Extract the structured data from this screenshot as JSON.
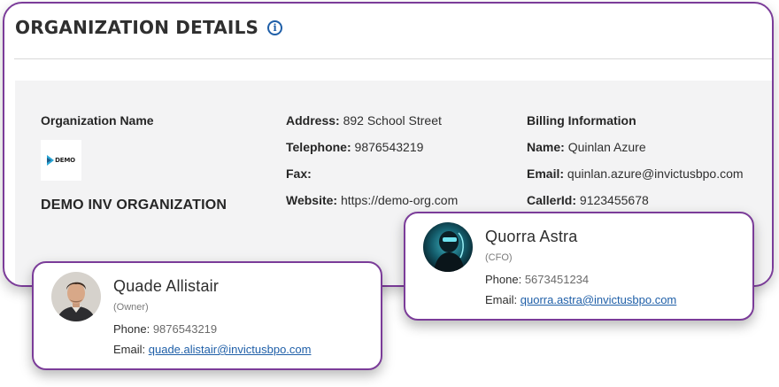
{
  "header": {
    "title": "ORGANIZATION DETAILS",
    "info_icon": "info-circle-icon"
  },
  "organization": {
    "name_label": "Organization Name",
    "logo_text": "DEMO",
    "display_name": "DEMO INV ORGANIZATION"
  },
  "contact": {
    "address_label": "Address:",
    "address": "892 School Street",
    "telephone_label": "Telephone:",
    "telephone": "9876543219",
    "fax_label": "Fax:",
    "fax": "",
    "website_label": "Website:",
    "website": "https://demo-org.com"
  },
  "billing": {
    "heading": "Billing Information",
    "name_label": "Name:",
    "name": "Quinlan Azure",
    "email_label": "Email:",
    "email": "quinlan.azure@invictusbpo.com",
    "callerid_label": "CallerId:",
    "callerid": "9123455678"
  },
  "people": [
    {
      "name": "Quade Allistair",
      "role": "(Owner)",
      "phone_label": "Phone:",
      "phone": "9876543219",
      "email_label": "Email:",
      "email": "quade.alistair@invictusbpo.com"
    },
    {
      "name": "Quorra Astra",
      "role": "(CFO)",
      "phone_label": "Phone:",
      "phone": "5673451234",
      "email_label": "Email:",
      "email": "quorra.astra@invictusbpo.com"
    }
  ],
  "colors": {
    "card_border": "#7b3c99",
    "link": "#1f5fa8",
    "panel_bg": "#f3f3f4"
  }
}
